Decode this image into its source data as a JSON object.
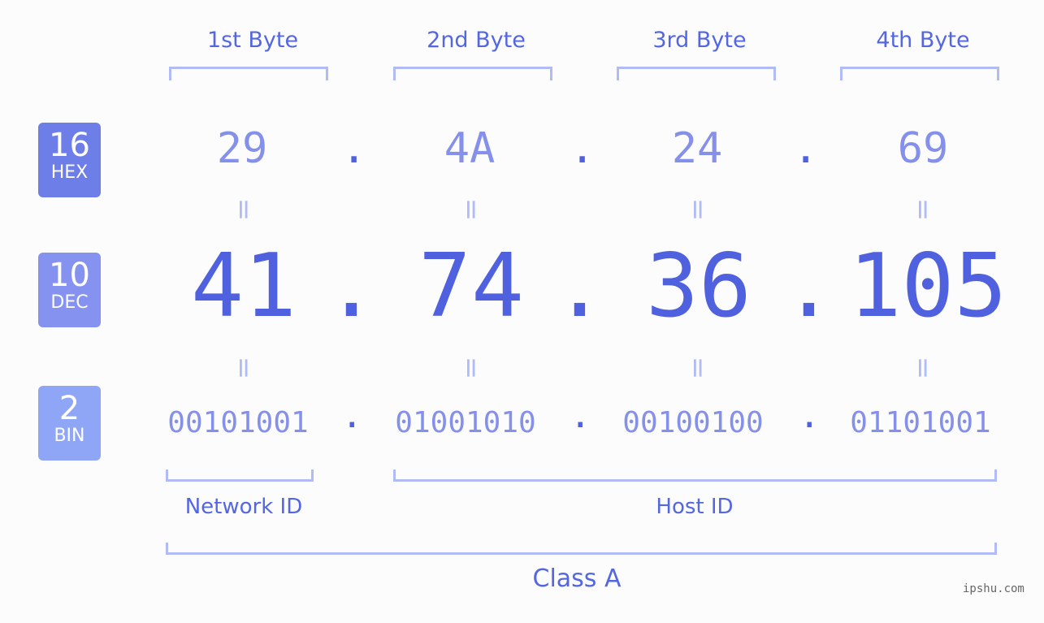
{
  "bytes": [
    {
      "label": "1st Byte",
      "hex": "29",
      "dec": "41",
      "bin": "00101001"
    },
    {
      "label": "2nd Byte",
      "hex": "4A",
      "dec": "74",
      "bin": "01001010"
    },
    {
      "label": "3rd Byte",
      "hex": "24",
      "dec": "36",
      "bin": "00100100"
    },
    {
      "label": "4th Byte",
      "hex": "69",
      "dec": "105",
      "bin": "01101001"
    }
  ],
  "badges": {
    "hex": {
      "num": "16",
      "label": "HEX",
      "color": "#6e7ee8"
    },
    "dec": {
      "num": "10",
      "label": "DEC",
      "color": "#8592ef"
    },
    "bin": {
      "num": "2",
      "label": "BIN",
      "color": "#8fa6f6"
    }
  },
  "separator": ".",
  "equals": "=",
  "network_id": "Network ID",
  "host_id": "Host ID",
  "class_label": "Class A",
  "watermark": "ipshu.com"
}
